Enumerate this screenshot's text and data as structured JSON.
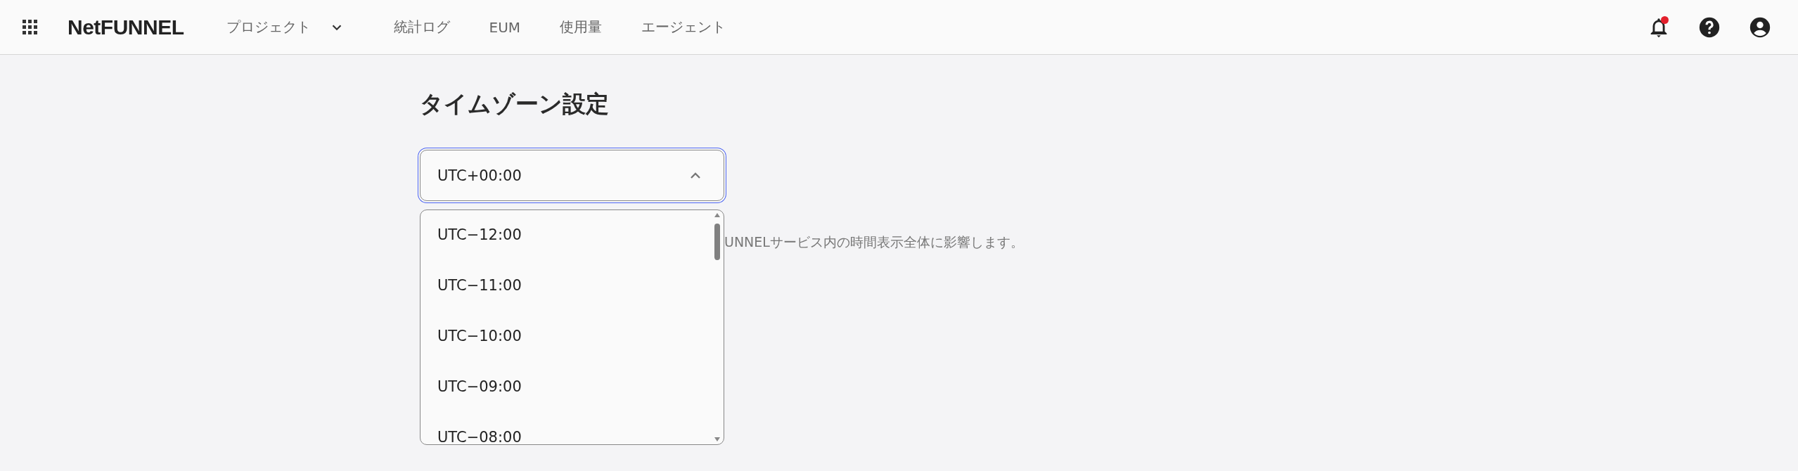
{
  "header": {
    "logo": "NetFUNNEL",
    "nav": [
      {
        "label": "プロジェクト",
        "kind": "dropdown"
      },
      {
        "label": "統計ログ",
        "kind": "link"
      },
      {
        "label": "EUM",
        "kind": "link"
      },
      {
        "label": "使用量",
        "kind": "link"
      },
      {
        "label": "エージェント",
        "kind": "link"
      }
    ],
    "notifications": {
      "unread": true
    }
  },
  "page": {
    "title": "タイムゾーン設定",
    "timezone_select": {
      "value": "UTC+00:00",
      "expanded": true,
      "options": [
        {
          "label": "UTC−12:00",
          "selected": false
        },
        {
          "label": "UTC−11:00",
          "selected": false
        },
        {
          "label": "UTC−10:00",
          "selected": false
        },
        {
          "label": "UTC−09:00",
          "selected": false
        },
        {
          "label": "UTC−08:00",
          "selected": false
        }
      ]
    },
    "helper_text": "UNNELサービス内の時間表示全体に影響します。"
  }
}
